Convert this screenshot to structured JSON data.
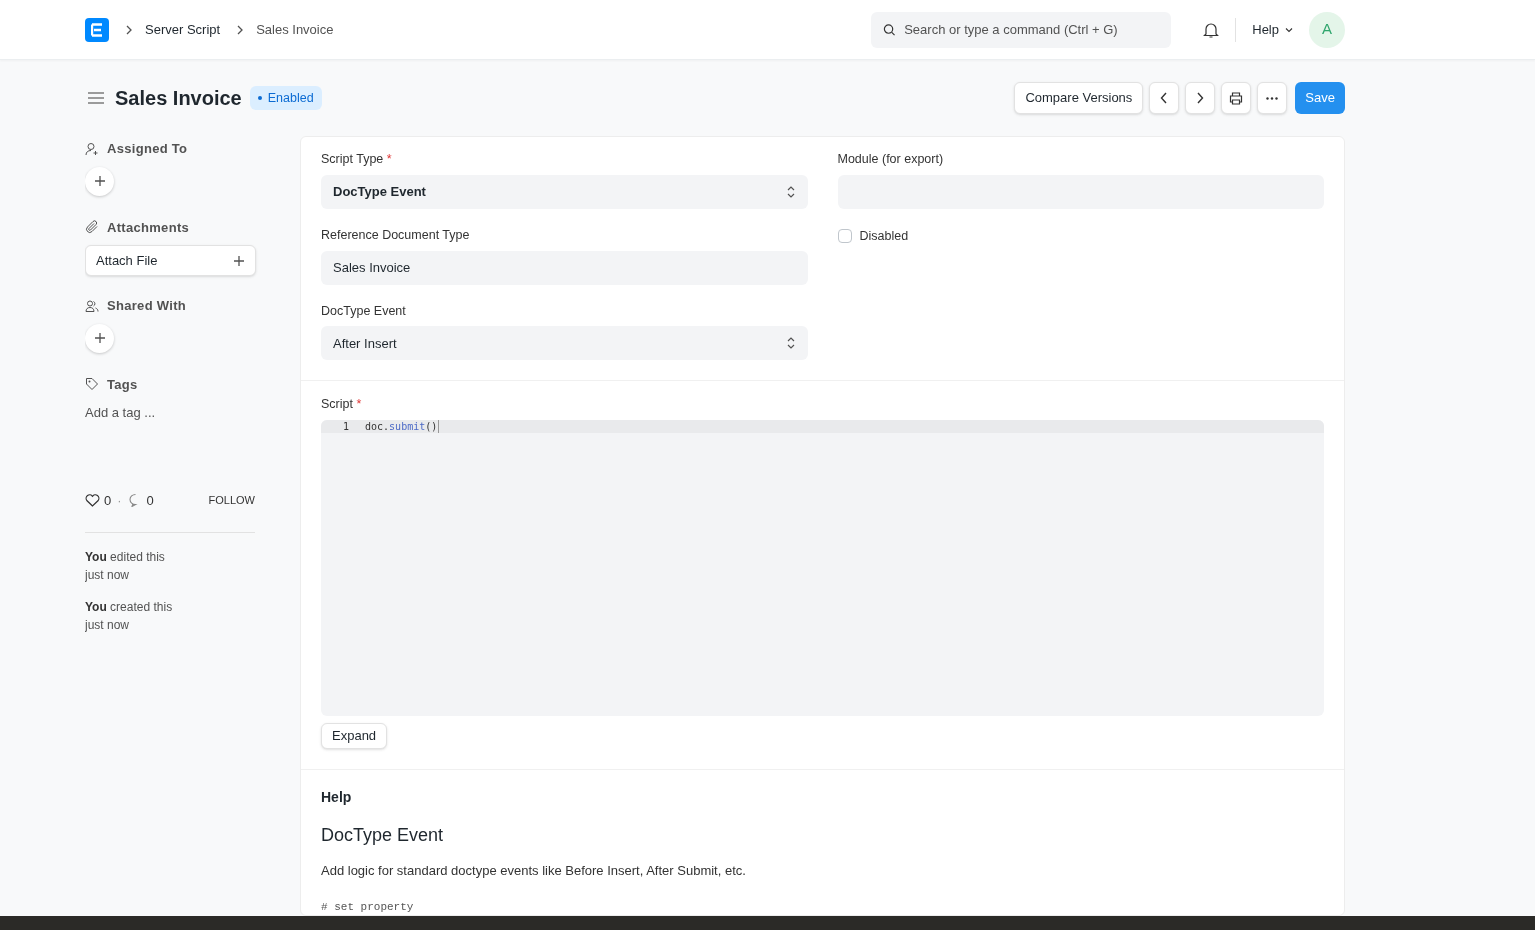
{
  "breadcrumbs": [
    "Server Script",
    "Sales Invoice"
  ],
  "search": {
    "placeholder": "Search or type a command (Ctrl + G)"
  },
  "help_menu": "Help",
  "avatar": "A",
  "title": "Sales Invoice",
  "status": {
    "label": "Enabled"
  },
  "actions": {
    "compare": "Compare Versions",
    "save": "Save"
  },
  "sidebar": {
    "assigned_to": "Assigned To",
    "attachments": "Attachments",
    "attach_file": "Attach File",
    "shared_with": "Shared With",
    "tags": "Tags",
    "add_tag": "Add a tag ...",
    "likes": "0",
    "separator": "·",
    "comments": "0",
    "follow": "FOLLOW",
    "activity": [
      {
        "text": "**You** edited this",
        "time": "just now"
      },
      {
        "text": "**You** created this",
        "time": "just now"
      }
    ]
  },
  "form": {
    "left": [
      {
        "kind": "select",
        "label": "Script Type",
        "required_mark": "*",
        "value": "DocType Event",
        "bold": true
      },
      {
        "kind": "text",
        "label": "Reference Document Type",
        "value": "Sales Invoice",
        "bold": false
      },
      {
        "kind": "select",
        "label": "DocType Event",
        "value": "After Insert",
        "bold": false
      }
    ],
    "module": {
      "label": "Module (for export)"
    },
    "disabled": {
      "label": "Disabled",
      "checked": false
    },
    "script": {
      "label": "Script",
      "required_mark": "*",
      "lines": [
        {
          "number": "1",
          "object": "doc.",
          "method": "submit",
          "args": "()"
        }
      ]
    },
    "expand": "Expand"
  },
  "help": {
    "heading": "Help",
    "title": "DocType Event",
    "description": "Add logic for standard doctype events like Before Insert, After Submit, etc.",
    "code": "# set property"
  }
}
